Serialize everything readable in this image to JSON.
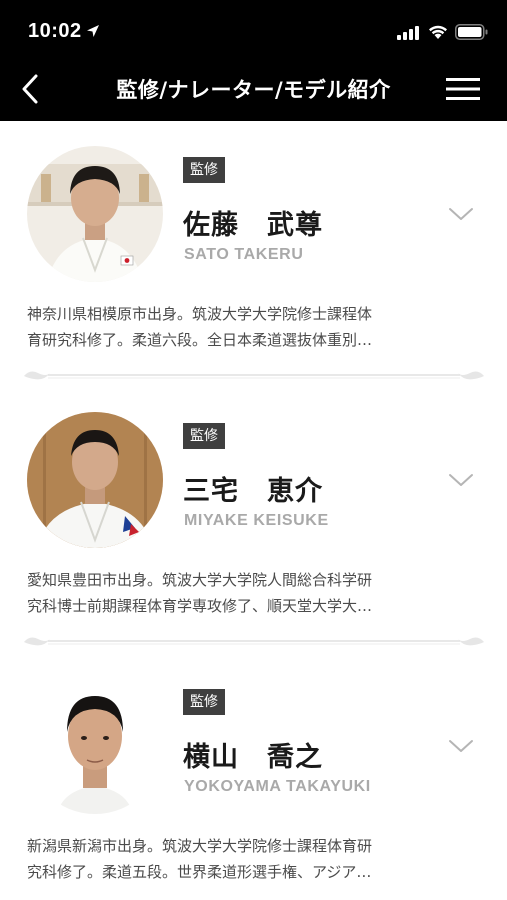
{
  "status_bar": {
    "time": "10:02"
  },
  "header": {
    "title": "監修/ナレーター/モデル紹介"
  },
  "members": [
    {
      "badge": "監修",
      "name": "佐藤　武尊",
      "roman": "SATO TAKERU",
      "bio_line1": "神奈川県相模原市出身。筑波大学大学院修士課程体",
      "bio_line2": "育研究科修了。柔道六段。全日本柔道選抜体重別…"
    },
    {
      "badge": "監修",
      "name": "三宅　恵介",
      "roman": "MIYAKE KEISUKE",
      "bio_line1": "愛知県豊田市出身。筑波大学大学院人間総合科学研",
      "bio_line2": "究科博士前期課程体育学専攻修了、順天堂大学大…"
    },
    {
      "badge": "監修",
      "name": "横山　喬之",
      "roman": "YOKOYAMA TAKAYUKI",
      "bio_line1": "新潟県新潟市出身。筑波大学大学院修士課程体育研",
      "bio_line2": "究科修了。柔道五段。世界柔道形選手権、アジア…"
    }
  ],
  "colors": {
    "header_bg": "#000000",
    "badge_bg": "#3f3f3f",
    "roman_text": "#a9a9a9",
    "divider": "#e2e2e2"
  }
}
